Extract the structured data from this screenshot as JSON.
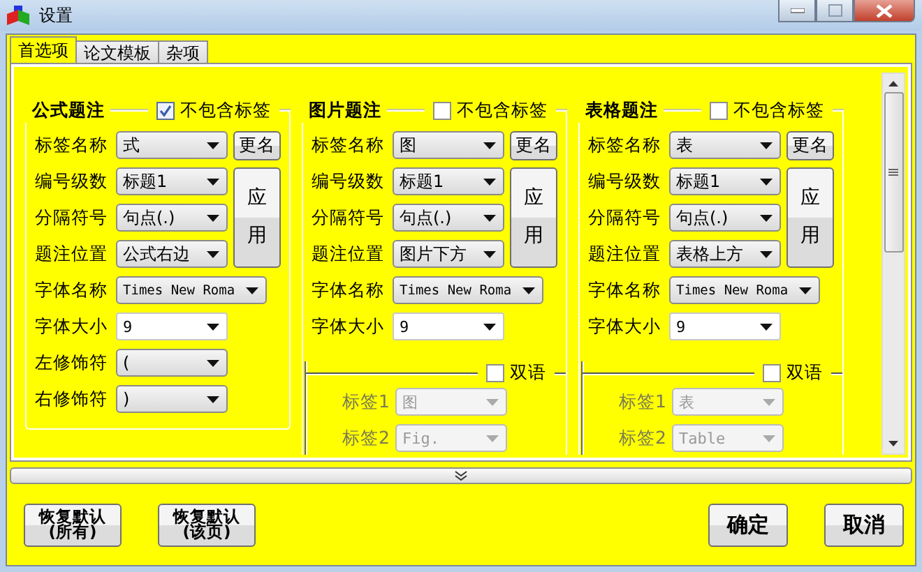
{
  "window": {
    "title": "设置"
  },
  "tabs": [
    {
      "label": "首选项",
      "selected": true
    },
    {
      "label": "论文模板",
      "selected": false
    },
    {
      "label": "杂项",
      "selected": false
    }
  ],
  "groups": [
    {
      "title": "公式题注",
      "exclude": {
        "label": "不包含标签",
        "checked": true
      },
      "rename_button": "更名",
      "apply_button": "应用",
      "fields": [
        {
          "label": "标签名称",
          "value": "式",
          "kind": "select"
        },
        {
          "label": "编号级数",
          "value": "标题1",
          "kind": "select"
        },
        {
          "label": "分隔符号",
          "value": "句点(.)",
          "kind": "select"
        },
        {
          "label": "题注位置",
          "value": "公式右边",
          "kind": "select"
        },
        {
          "label": "字体名称",
          "value": "Times New Roma",
          "kind": "font"
        },
        {
          "label": "字体大小",
          "value": "9",
          "kind": "combo"
        },
        {
          "label": "左修饰符",
          "value": "(",
          "kind": "select"
        },
        {
          "label": "右修饰符",
          "value": ")",
          "kind": "select"
        }
      ]
    },
    {
      "title": "图片题注",
      "exclude": {
        "label": "不包含标签",
        "checked": false
      },
      "rename_button": "更名",
      "apply_button": "应用",
      "fields": [
        {
          "label": "标签名称",
          "value": "图",
          "kind": "select"
        },
        {
          "label": "编号级数",
          "value": "标题1",
          "kind": "select"
        },
        {
          "label": "分隔符号",
          "value": "句点(.)",
          "kind": "select"
        },
        {
          "label": "题注位置",
          "value": "图片下方",
          "kind": "select"
        },
        {
          "label": "字体名称",
          "value": "Times New Roma",
          "kind": "font"
        },
        {
          "label": "字体大小",
          "value": "9",
          "kind": "combo"
        }
      ],
      "bilingual": {
        "label": "双语",
        "checked": false,
        "fields": [
          {
            "label": "标签1",
            "value": "图",
            "disabled": true
          },
          {
            "label": "标签2",
            "value": "Fig.",
            "disabled": true
          }
        ]
      }
    },
    {
      "title": "表格题注",
      "exclude": {
        "label": "不包含标签",
        "checked": false
      },
      "rename_button": "更名",
      "apply_button": "应用",
      "fields": [
        {
          "label": "标签名称",
          "value": "表",
          "kind": "select"
        },
        {
          "label": "编号级数",
          "value": "标题1",
          "kind": "select"
        },
        {
          "label": "分隔符号",
          "value": "句点(.)",
          "kind": "select"
        },
        {
          "label": "题注位置",
          "value": "表格上方",
          "kind": "select"
        },
        {
          "label": "字体名称",
          "value": "Times New Roma",
          "kind": "font"
        },
        {
          "label": "字体大小",
          "value": "9",
          "kind": "combo"
        }
      ],
      "bilingual": {
        "label": "双语",
        "checked": false,
        "fields": [
          {
            "label": "标签1",
            "value": "表",
            "disabled": true
          },
          {
            "label": "标签2",
            "value": "Table",
            "disabled": true
          }
        ]
      }
    }
  ],
  "buttons": [
    {
      "label": "恢复默认(所有)",
      "kind": "left"
    },
    {
      "label": "恢复默认(该页)",
      "kind": "left"
    },
    {
      "label": "确定",
      "kind": "right"
    },
    {
      "label": "取消",
      "kind": "right"
    }
  ]
}
